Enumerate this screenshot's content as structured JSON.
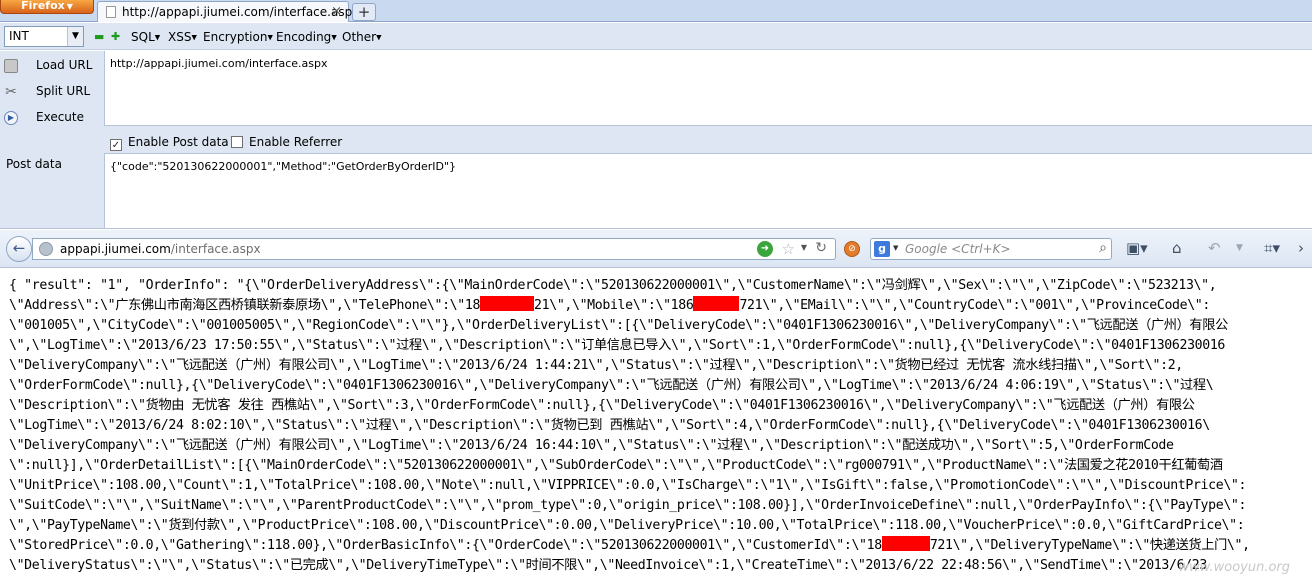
{
  "browser": {
    "app_button": "Firefox",
    "tab_title": "http://appapi.jiumei.com/interface.aspx"
  },
  "hackbar": {
    "type_value": "INT",
    "menus": [
      "SQL",
      "XSS",
      "Encryption",
      "Encoding",
      "Other"
    ],
    "load_url": "Load URL",
    "split_url": "Split URL",
    "execute": "Execute",
    "url_value": "http://appapi.jiumei.com/interface.aspx",
    "enable_post": "Enable Post data",
    "enable_referrer": "Enable Referrer",
    "post_label": "Post data",
    "post_value": "{\"code\":\"520130622000001\",\"Method\":\"GetOrderByOrderID\"}"
  },
  "navbar": {
    "url_host": "appapi.jiumei.com",
    "url_path": "/interface.aspx",
    "search_placeholder": "Google <Ctrl+K>"
  },
  "content": {
    "lines": [
      "{ \"result\": \"1\", \"OrderInfo\": \"{\\\"OrderDeliveryAddress\\\":{\\\"MainOrderCode\\\":\\\"520130622000001\\\",\\\"CustomerName\\\":\\\"冯剑辉\\\",\\\"Sex\\\":\\\"\\\",\\\"ZipCode\\\":\\\"523213\\\",",
      "\\\"Address\\\":\\\"广东佛山市南海区西桥镇联新泰原场\\\",\\\"TelePhone\\\":\\\"18",
      "\\\"001005\\\",\\\"CityCode\\\":\\\"001005005\\\",\\\"RegionCode\\\":\\\"\\\"},\\\"OrderDeliveryList\\\":[{\\\"DeliveryCode\\\":\\\"0401F1306230016\\\",\\\"DeliveryCompany\\\":\\\"飞远配送（广州）有限公",
      "\\\",\\\"LogTime\\\":\\\"2013/6/23 17:50:55\\\",\\\"Status\\\":\\\"过程\\\",\\\"Description\\\":\\\"订单信息已导入\\\",\\\"Sort\\\":1,\\\"OrderFormCode\\\":null},{\\\"DeliveryCode\\\":\\\"0401F1306230016",
      "\\\"DeliveryCompany\\\":\\\"飞远配送（广州）有限公司\\\",\\\"LogTime\\\":\\\"2013/6/24 1:44:21\\\",\\\"Status\\\":\\\"过程\\\",\\\"Description\\\":\\\"货物已经过 无忧客 流水线扫描\\\",\\\"Sort\\\":2,",
      "\\\"OrderFormCode\\\":null},{\\\"DeliveryCode\\\":\\\"0401F1306230016\\\",\\\"DeliveryCompany\\\":\\\"飞远配送（广州）有限公司\\\",\\\"LogTime\\\":\\\"2013/6/24 4:06:19\\\",\\\"Status\\\":\\\"过程\\",
      "\\\"Description\\\":\\\"货物由 无忧客 发往 西樵站\\\",\\\"Sort\\\":3,\\\"OrderFormCode\\\":null},{\\\"DeliveryCode\\\":\\\"0401F1306230016\\\",\\\"DeliveryCompany\\\":\\\"飞远配送（广州）有限公",
      "\\\"LogTime\\\":\\\"2013/6/24 8:02:10\\\",\\\"Status\\\":\\\"过程\\\",\\\"Description\\\":\\\"货物已到 西樵站\\\",\\\"Sort\\\":4,\\\"OrderFormCode\\\":null},{\\\"DeliveryCode\\\":\\\"0401F1306230016\\",
      "\\\"DeliveryCompany\\\":\\\"飞远配送（广州）有限公司\\\",\\\"LogTime\\\":\\\"2013/6/24 16:44:10\\\",\\\"Status\\\":\\\"过程\\\",\\\"Description\\\":\\\"配送成功\\\",\\\"Sort\\\":5,\\\"OrderFormCode",
      "\\\":null}],\\\"OrderDetailList\\\":[{\\\"MainOrderCode\\\":\\\"520130622000001\\\",\\\"SubOrderCode\\\":\\\"\\\",\\\"ProductCode\\\":\\\"rg000791\\\",\\\"ProductName\\\":\\\"法国爱之花2010干红葡萄酒",
      "\\\"UnitPrice\\\":108.00,\\\"Count\\\":1,\\\"TotalPrice\\\":108.00,\\\"Note\\\":null,\\\"VIPPRICE\\\":0.0,\\\"IsCharge\\\":\\\"1\\\",\\\"IsGift\\\":false,\\\"PromotionCode\\\":\\\"\\\",\\\"DiscountPrice\\\":",
      "\\\"SuitCode\\\":\\\"\\\",\\\"SuitName\\\":\\\"\\\",\\\"ParentProductCode\\\":\\\"\\\",\\\"prom_type\\\":0,\\\"origin_price\\\":108.00}],\\\"OrderInvoiceDefine\\\":null,\\\"OrderPayInfo\\\":{\\\"PayType\\\":",
      "\\\",\\\"PayTypeName\\\":\\\"货到付款\\\",\\\"ProductPrice\\\":108.00,\\\"DiscountPrice\\\":0.00,\\\"DeliveryPrice\\\":10.00,\\\"TotalPrice\\\":118.00,\\\"VoucherPrice\\\":0.0,\\\"GiftCardPrice\\\":",
      "\\\"StoredPrice\\\":0.0,\\\"Gathering\\\":118.00},\\\"OrderBasicInfo\\\":{\\\"OrderCode\\\":\\\"520130622000001\\\",\\\"CustomerId\\\":\\\"18",
      "\\\"DeliveryStatus\\\":\\\"\\\",\\\"Status\\\":\\\"已完成\\\",\\\"DeliveryTimeType\\\":\\\"时间不限\\\",\\\"NeedInvoice\\\":1,\\\"CreateTime\\\":\\\"2013/6/22 22:48:56\\\",\\\"SendTime\\\":\\\"2013/6/23"
    ],
    "line2_b": "21\\\",\\\"Mobile\\\":\\\"186",
    "line2_c": "721\\\",\\\"EMail\\\":\\\"\\\",\\\"CountryCode\\\":\\\"001\\\",\\\"ProvinceCode\\\":",
    "line14_b": "721\\\",\\\"DeliveryTypeName\\\":\\\"快递送货上门\\\",",
    "watermark": "www.wooyun.org"
  }
}
